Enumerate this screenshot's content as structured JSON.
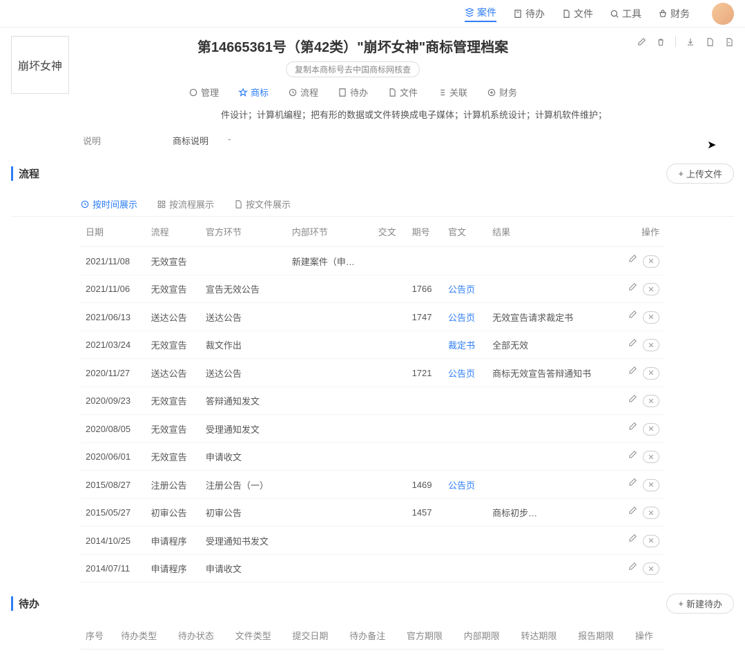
{
  "topnav": [
    {
      "label": "案件",
      "active": true
    },
    {
      "label": "待办",
      "active": false
    },
    {
      "label": "文件",
      "active": false
    },
    {
      "label": "工具",
      "active": false
    },
    {
      "label": "财务",
      "active": false
    }
  ],
  "logo_text": "崩坏女神",
  "page_title": "第14665361号（第42类）\"崩坏女神\"商标管理档案",
  "copy_hint": "复制本商标号去中国商标网核查",
  "subnav": [
    {
      "label": "管理"
    },
    {
      "label": "商标",
      "active": true
    },
    {
      "label": "流程"
    },
    {
      "label": "待办"
    },
    {
      "label": "文件"
    },
    {
      "label": "关联"
    },
    {
      "label": "财务"
    }
  ],
  "body_text": "件设计；计算机编程；把有形的数据或文件转换成电子媒体；计算机系统设计；计算机软件维护；",
  "desc": {
    "label": "说明",
    "key": "商标说明",
    "value": "-"
  },
  "section_flow": {
    "title": "流程",
    "upload": "上传文件"
  },
  "flow_tabs": [
    {
      "label": "按时间展示",
      "active": true
    },
    {
      "label": "按流程展示"
    },
    {
      "label": "按文件展示"
    }
  ],
  "flow_cols": [
    "日期",
    "流程",
    "官方环节",
    "内部环节",
    "交文",
    "期号",
    "官文",
    "结果",
    "操作"
  ],
  "flow_rows": [
    {
      "date": "2021/11/08",
      "flow": "无效宣告",
      "official": "",
      "internal": "新建案件（申…",
      "jiao": "",
      "issue": "",
      "doc": "",
      "result": ""
    },
    {
      "date": "2021/11/06",
      "flow": "无效宣告",
      "official": "宣告无效公告",
      "internal": "",
      "jiao": "",
      "issue": "1766",
      "doc": "公告页",
      "result": ""
    },
    {
      "date": "2021/06/13",
      "flow": "送达公告",
      "official": "送达公告",
      "internal": "",
      "jiao": "",
      "issue": "1747",
      "doc": "公告页",
      "result": "无效宣告请求裁定书"
    },
    {
      "date": "2021/03/24",
      "flow": "无效宣告",
      "official": "裁文作出",
      "internal": "",
      "jiao": "",
      "issue": "",
      "doc": "裁定书",
      "result": "全部无效"
    },
    {
      "date": "2020/11/27",
      "flow": "送达公告",
      "official": "送达公告",
      "internal": "",
      "jiao": "",
      "issue": "1721",
      "doc": "公告页",
      "result": "商标无效宣告答辩通知书"
    },
    {
      "date": "2020/09/23",
      "flow": "无效宣告",
      "official": "答辩通知发文",
      "internal": "",
      "jiao": "",
      "issue": "",
      "doc": "",
      "result": ""
    },
    {
      "date": "2020/08/05",
      "flow": "无效宣告",
      "official": "受理通知发文",
      "internal": "",
      "jiao": "",
      "issue": "",
      "doc": "",
      "result": ""
    },
    {
      "date": "2020/06/01",
      "flow": "无效宣告",
      "official": "申请收文",
      "internal": "",
      "jiao": "",
      "issue": "",
      "doc": "",
      "result": ""
    },
    {
      "date": "2015/08/27",
      "flow": "注册公告",
      "official": "注册公告（一）",
      "internal": "",
      "jiao": "",
      "issue": "1469",
      "doc": "公告页",
      "result": ""
    },
    {
      "date": "2015/05/27",
      "flow": "初审公告",
      "official": "初审公告",
      "internal": "",
      "jiao": "",
      "issue": "1457",
      "doc": "",
      "result": "商标初步…"
    },
    {
      "date": "2014/10/25",
      "flow": "申请程序",
      "official": "受理通知书发文",
      "internal": "",
      "jiao": "",
      "issue": "",
      "doc": "",
      "result": ""
    },
    {
      "date": "2014/07/11",
      "flow": "申请程序",
      "official": "申请收文",
      "internal": "",
      "jiao": "",
      "issue": "",
      "doc": "",
      "result": ""
    }
  ],
  "section_todo": {
    "title": "待办",
    "new": "新建待办"
  },
  "todo_cols": [
    "序号",
    "待办类型",
    "待办状态",
    "文件类型",
    "提交日期",
    "待办备注",
    "官方期限",
    "内部期限",
    "转达期限",
    "报告期限",
    "操作"
  ]
}
